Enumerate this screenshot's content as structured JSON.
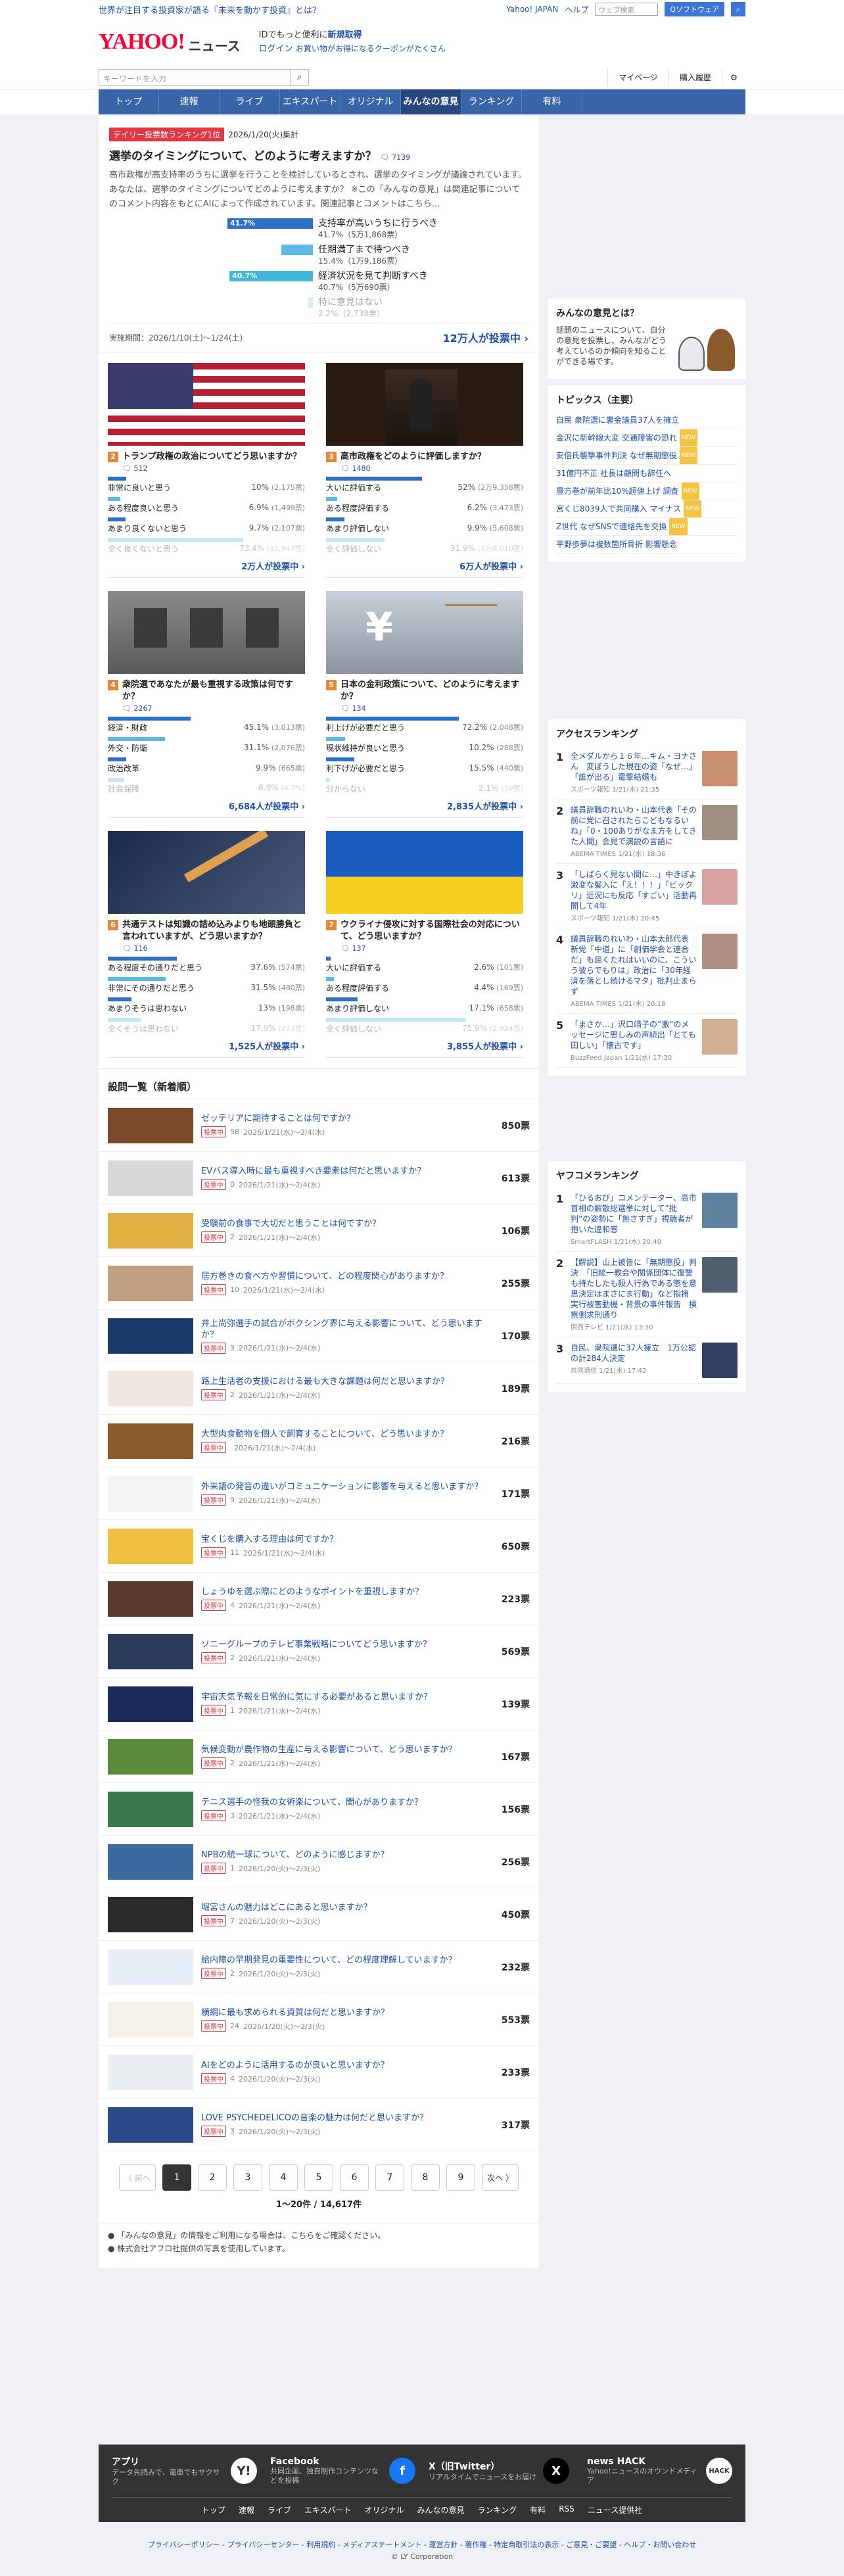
{
  "promo": {
    "text": "世界が注目する投資家が語る『未来を動かす投資』とは？",
    "links": [
      "Yahoo! JAPAN",
      "ヘルプ"
    ],
    "search_placeholder": "ウェブ検索",
    "search_btn": "Qソフトウェア",
    "mini_btn": "Q"
  },
  "header": {
    "logo": "YAHOO!",
    "logo_sub": "JAPAN",
    "section": "ニュース",
    "login_line1": "IDでもっと便利に",
    "login_new": "新規取得",
    "login_line2": "ログイン",
    "coupon": "お買い物がお得になるクーポンがたくさん"
  },
  "search": {
    "placeholder": "キーワードを入力",
    "right": [
      "マイページ",
      "購入履歴"
    ]
  },
  "nav": [
    "トップ",
    "速報",
    "ライブ",
    "エキスパート",
    "オリジナル",
    "みんなの意見",
    "ランキング",
    "有料"
  ],
  "hero": {
    "badge": "デイリー投票数ランキング1位",
    "date": "2026/1/20(火)集計",
    "title": "選挙のタイミングについて、どのように考えますか？",
    "comments": "7139",
    "desc": "高市政権が高支持率のうちに選挙を行うことを検討しているとされ、選挙のタイミングが議論されています。あなたは、選挙のタイミングについてどのように考えますか？ ※この「みんなの意見」は関連記事についてのコメント内容をもとにAIによって作成されています。関連記事とコメントはこちら...",
    "options": [
      {
        "label": "支持率が高いうちに行うべき",
        "pct": "41.7%",
        "votes": "41.7%（5万1,868票）",
        "value": 41.7
      },
      {
        "label": "任期満了まで待つべき",
        "pct": "",
        "votes": "15.4%（1万9,186票）",
        "value": 15.4
      },
      {
        "label": "経済状況を見て判断すべき",
        "pct": "40.7%",
        "votes": "40.7%（5万690票）",
        "value": 40.7
      },
      {
        "label": "特に意見はない",
        "pct": "",
        "votes": "2.2%（2,738票）",
        "value": 2.2
      }
    ],
    "period": "実施期間：2026/1/10(土)〜1/24(土)",
    "total": "12万人が投票中"
  },
  "cards": [
    {
      "num": "2",
      "title": "トランプ政権の政治についてどう思いますか？",
      "comments": "512",
      "img": "flag-us",
      "options": [
        [
          "非常に良いと思う",
          "10%",
          "(2,175票)",
          10
        ],
        [
          "ある程度良いと思う",
          "6.9%",
          "(1,499票)",
          6.9
        ],
        [
          "あまり良くないと思う",
          "9.7%",
          "(2,107票)",
          9.7
        ],
        [
          "全く良くないと思う",
          "73.4%",
          "(15,947票)",
          73.4
        ]
      ],
      "total": "2万人が投票中"
    },
    {
      "num": "3",
      "title": "高市政権をどのように評価しますか？",
      "comments": "1480",
      "img": "podium",
      "options": [
        [
          "大いに評価する",
          "52%",
          "(2万9,358票)",
          52
        ],
        [
          "ある程度評価する",
          "6.2%",
          "(3,473票)",
          6.2
        ],
        [
          "あまり評価しない",
          "9.9%",
          "(5,608票)",
          9.9
        ],
        [
          "全く評価しない",
          "31.9%",
          "(1万8,010票)",
          31.9
        ]
      ],
      "total": "6万人が投票中"
    },
    {
      "num": "4",
      "title": "衆院選であなたが最も重視する政策は何ですか？",
      "comments": "2267",
      "img": "building",
      "options": [
        [
          "経済・財政",
          "45.1%",
          "(3,013票)",
          45.1
        ],
        [
          "外交・防衛",
          "31.1%",
          "(2,076票)",
          31.1
        ],
        [
          "政治改革",
          "9.9%",
          "(665票)",
          9.9
        ],
        [
          "社会保障",
          "8.9%",
          "(4.7%)",
          8.9
        ]
      ],
      "total": "6,684人が投票中"
    },
    {
      "num": "5",
      "title": "日本の金利政策について、どのように考えますか？",
      "comments": "134",
      "img": "scale",
      "options": [
        [
          "利上げが必要だと思う",
          "72.2%",
          "(2,048票)",
          72.2
        ],
        [
          "現状維持が良いと思う",
          "10.2%",
          "(288票)",
          10.2
        ],
        [
          "利下げが必要だと思う",
          "15.5%",
          "(440票)",
          15.5
        ],
        [
          "分からない",
          "2.1%",
          "(59票)",
          2.1
        ]
      ],
      "total": "2,835人が投票中"
    },
    {
      "num": "6",
      "title": "共通テストは知識の詰め込みよりも地頭勝負と言われていますが、どう思いますか？",
      "comments": "116",
      "img": "pencil",
      "options": [
        [
          "ある程度その通りだと思う",
          "37.6%",
          "(574票)",
          37.6
        ],
        [
          "非常にその通りだと思う",
          "31.5%",
          "(480票)",
          31.5
        ],
        [
          "あまりそうは思わない",
          "13%",
          "(198票)",
          13
        ],
        [
          "全くそうは思わない",
          "17.9%",
          "(273票)",
          17.9
        ]
      ],
      "total": "1,525人が投票中"
    },
    {
      "num": "7",
      "title": "ウクライナ侵攻に対する国際社会の対応について、どう思いますか？",
      "comments": "137",
      "img": "flag-ua",
      "options": [
        [
          "大いに評価する",
          "2.6%",
          "(101票)",
          2.6
        ],
        [
          "ある程度評価する",
          "4.4%",
          "(169票)",
          4.4
        ],
        [
          "あまり評価しない",
          "17.1%",
          "(658票)",
          17.1
        ],
        [
          "全く評価しない",
          "75.9%",
          "(2,924票)",
          75.9
        ]
      ],
      "total": "3,855人が投票中"
    }
  ],
  "list_title": "設問一覧（新着順）",
  "list": [
    {
      "title": "ゼッテリアに期待することは何ですか？",
      "c": "58",
      "d": "2026/1/21(水)〜2/4(水)",
      "v": "850票",
      "bg": "#7a4a2a"
    },
    {
      "title": "EVバス導入時に最も重視すべき要素は何だと思いますか？",
      "c": "0",
      "d": "2026/1/21(水)〜2/4(水)",
      "v": "613票",
      "bg": "#d8d8d8"
    },
    {
      "title": "受験前の食事で大切だと思うことは何ですか？",
      "c": "2",
      "d": "2026/1/21(水)〜2/4(水)",
      "v": "106票",
      "bg": "#e0b040"
    },
    {
      "title": "居方巻きの食べ方や習慣について、どの程度関心がありますか？",
      "c": "10",
      "d": "2026/1/21(水)〜2/4(水)",
      "v": "255票",
      "bg": "#c0a080"
    },
    {
      "title": "井上尚弥選手の試合がボクシング界に与える影響について、どう思いますか？",
      "c": "3",
      "d": "2026/1/21(水)〜2/4(水)",
      "v": "170票",
      "bg": "#1a3a6a"
    },
    {
      "title": "路上生活者の支援における最も大きな課題は何だと思いますか？",
      "c": "2",
      "d": "2026/1/21(水)〜2/4(水)",
      "v": "189票",
      "bg": "#f0e8e0"
    },
    {
      "title": "大型肉食動物を個人で飼育することについて、どう思いますか？",
      "c": "",
      "d": "2026/1/21(水)〜2/4(水)",
      "v": "216票",
      "bg": "#8a5a2a"
    },
    {
      "title": "外来語の発音の違いがコミュニケーションに影響を与えると思いますか？",
      "c": "9",
      "d": "2026/1/21(水)〜2/4(水)",
      "v": "171票",
      "bg": "#f4f4f4"
    },
    {
      "title": "宝くじを購入する理由は何ですか？",
      "c": "11",
      "d": "2026/1/21(水)〜2/4(水)",
      "v": "650票",
      "bg": "#f0c040"
    },
    {
      "title": "しょうゆを選ぶ際にどのようなポイントを重視しますか？",
      "c": "4",
      "d": "2026/1/21(水)〜2/4(水)",
      "v": "223票",
      "bg": "#5a3a2a"
    },
    {
      "title": "ソニーグループのテレビ事業戦略についてどう思いますか？",
      "c": "2",
      "d": "2026/1/21(水)〜2/4(水)",
      "v": "569票",
      "bg": "#2a3a5a"
    },
    {
      "title": "宇宙天気予報を日常的に気にする必要があると思いますか？",
      "c": "1",
      "d": "2026/1/21(水)〜2/4(水)",
      "v": "139票",
      "bg": "#1a2a5a"
    },
    {
      "title": "気候変動が農作物の生産に与える影響について、どう思いますか？",
      "c": "2",
      "d": "2026/1/21(水)〜2/4(水)",
      "v": "167票",
      "bg": "#5a8a3a"
    },
    {
      "title": "テニス選手の怪我の女術楽について、関心がありますか？",
      "c": "3",
      "d": "2026/1/21(水)〜2/4(水)",
      "v": "156票",
      "bg": "#3a7a4a"
    },
    {
      "title": "NPBの統一球について、どのように感じますか？",
      "c": "1",
      "d": "2026/1/20(火)〜2/3(火)",
      "v": "256票",
      "bg": "#3a6aa0"
    },
    {
      "title": "堀宮さんの魅力はどこにあると思いますか？",
      "c": "7",
      "d": "2026/1/20(火)〜2/3(火)",
      "v": "450票",
      "bg": "#2a2a2a"
    },
    {
      "title": "給内障の早期発見の重要性について、どの程度理解していますか？",
      "c": "2",
      "d": "2026/1/20(火)〜2/3(火)",
      "v": "232票",
      "bg": "#e8eef8"
    },
    {
      "title": "横綱に最も求められる資質は何だと思いますか？",
      "c": "24",
      "d": "2026/1/20(火)〜2/3(火)",
      "v": "553票",
      "bg": "#f4f0e8"
    },
    {
      "title": "AIをどのように活用するのが良いと思いますか？",
      "c": "4",
      "d": "2026/1/20(火)〜2/3(火)",
      "v": "233票",
      "bg": "#e8f0f4"
    },
    {
      "title": "LOVE PSYCHEDELICOの音楽の魅力は何だと思いますか？",
      "c": "3",
      "d": "2026/1/20(火)〜2/3(火)",
      "v": "317票",
      "bg": "#2a4a8a"
    }
  ],
  "list_tag": "投票中",
  "pager": {
    "prev": "〈 前へ",
    "pages": [
      "1",
      "2",
      "3",
      "4",
      "5",
      "6",
      "7",
      "8",
      "9"
    ],
    "next": "次へ 〉",
    "count": "1〜20件 / 14,617件"
  },
  "notes": [
    "「みんなの意見」の情報をご利用になる場合は、こちらをご確認ください。",
    "株式会社アフロ社提供の写真を使用しています。"
  ],
  "side": {
    "about_title": "みんなの意見とは？",
    "about_text": "話題のニュースについて、自分の意見を投票し、みんながどう考えているのか傾向を知ることができる場です。",
    "topics_title": "トピックス（主要）",
    "topics": [
      [
        "自民 衆院選に裏金議員37人を擁立",
        ""
      ],
      [
        "金沢に新幹線大変 交通障害の恐れ",
        "NEW"
      ],
      [
        "安倍氏襲撃事件判決 なぜ無期懲役",
        "NEW"
      ],
      [
        "31億円不正 社長は顧問も辞任へ",
        ""
      ],
      [
        "豊方巻が前年比10%超値上げ 調査",
        "NEW"
      ],
      [
        "宮くじ8039人で共同購入 マイナス",
        "NEW"
      ],
      [
        "Z世代 なぜSNSで連絡先を交換",
        "NEW"
      ],
      [
        "平野歩夢は複数箇所骨折 影響懸念",
        ""
      ]
    ],
    "access_title": "アクセスランキング",
    "access": [
      [
        "全メダルから１６年…キム・ヨナさん　変ぼうした現在の姿「なぜ…」「誰が出る」電撃結婚も",
        "スポーツ報知 1/21(水) 21:35",
        "#c89070"
      ],
      [
        "議員辞職のれいわ・山本代表「その前に党に召されたらこどもなるいね」「0・100ありがなま方をしてきた人間」会見で演説の言語に",
        "ABEMA TIMES 1/21(水) 18:36",
        "#a09080"
      ],
      [
        "「しばらく見ない間に…」中きぼよ　激変な髪入に「え！！！」「ビックリ」近況にも反応「すごい」活動再開して4年",
        "スポーツ報知 1/21(水) 20:45",
        "#d8a0a0"
      ],
      [
        "議員辞職のれいわ・山本太郎代表　新党「中道」に「創価学会と連合だ」も屈くたれはいいのに、こういう彼らでもりは」政治に「30年経済を落とし続けるマタ」批判止まらず",
        "ABEMA TIMES 1/21(水) 20:18",
        "#b09080"
      ],
      [
        "「まさか…」沢口靖子の”激”のメッセージに思しみの声続出「とても田しい」「懐古です」",
        "BuzzFeed Japan 1/21(水) 17:30",
        "#d0b090"
      ]
    ],
    "comment_title": "ヤフコメランキング",
    "comment": [
      [
        "「ひるおび」コメンテーター、高市首相の解散総選挙に対して”批判”の姿勢に「無さすぎ」視聴者が抱いた違和感",
        "SmartFLASH 1/21(水) 20:40",
        "#6080a0"
      ],
      [
        "【解説】山上被告に「無期懲役」判決　「旧統一教会や関係団体に復讐も持たしたも殺人行為である懲を意思決定はまさにま行動」など指摘　実行被害動機・背景の事件報告　検察側求刑通り",
        "関西テレビ 1/21(水) 13:30",
        "#506070"
      ],
      [
        "自民、衆院選に37人擁立　1万公認の計284人決定",
        "共同通信 1/21(水) 17:42",
        "#304060"
      ]
    ]
  },
  "footer": {
    "apps": [
      {
        "t": "アプリ",
        "d": "データ先読みで、電車でもサクサク",
        "ic": "Y!"
      },
      {
        "t": "Facebook",
        "d": "共同企画、独自制作コンテンツなどを投稿",
        "ic": "f"
      },
      {
        "t": "X（旧Twitter）",
        "d": "リアルタイムでニュースをお届け",
        "ic": "X"
      },
      {
        "t": "news HACK",
        "d": "Yahoo!ニュースのオウンドメディア",
        "ic": "HACK"
      }
    ],
    "nav": [
      "トップ",
      "速報",
      "ライブ",
      "エキスパート",
      "オリジナル",
      "みんなの意見",
      "ランキング",
      "有料",
      "RSS",
      "ニュース提供社"
    ]
  },
  "bottom": {
    "links": "プライバシーポリシー - プライバシーセンター - 利用規約 - メディアステートメント - 運営方針 - 著作権 - 特定商取引法の表示 - ご意見・ご要望 - ヘルプ・お問い合わせ",
    "copy": "© LY Corporation"
  }
}
